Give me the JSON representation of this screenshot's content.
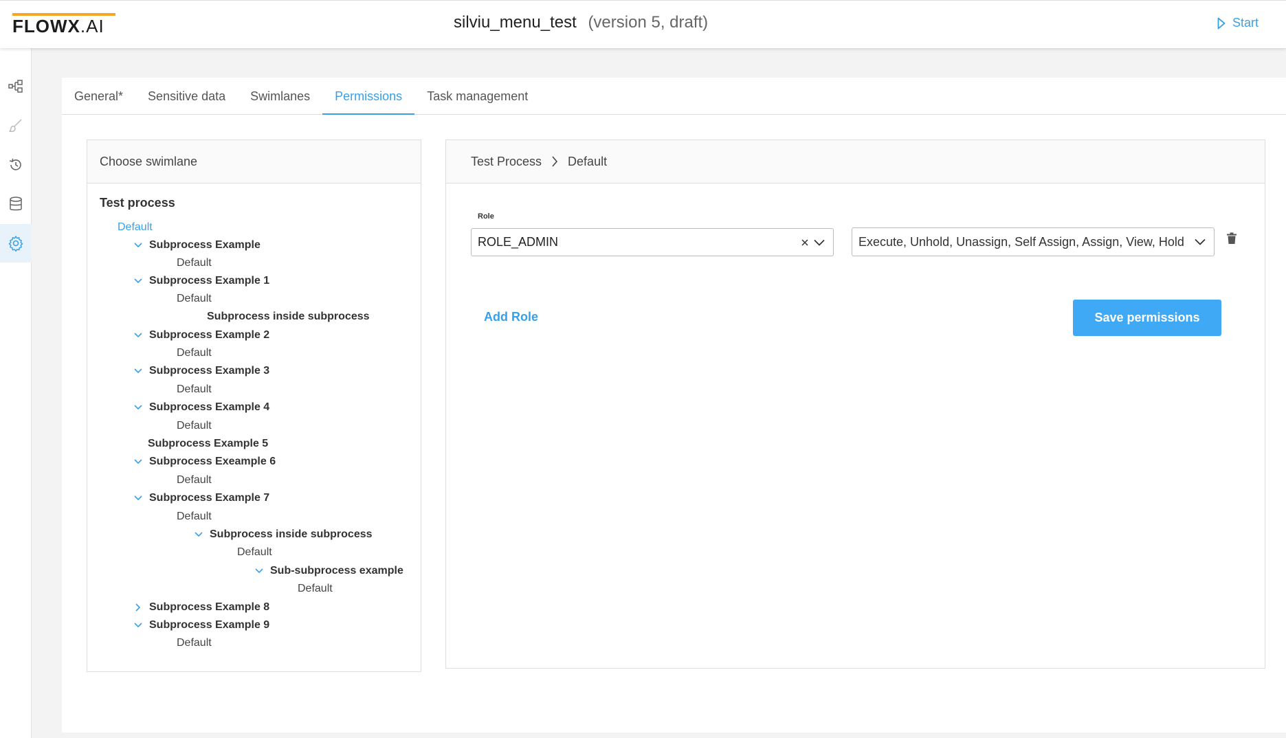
{
  "header": {
    "logo_main": "FLOWX",
    "logo_suffix": ".AI",
    "process_name": "silviu_menu_test",
    "version": "(version 5, draft)",
    "start_label": "Start"
  },
  "rail": {
    "items": [
      {
        "icon": "process-diagram-icon"
      },
      {
        "icon": "brush-icon"
      },
      {
        "icon": "history-icon"
      },
      {
        "icon": "database-icon"
      },
      {
        "icon": "settings-gear-icon",
        "active": true
      }
    ]
  },
  "tabs": [
    {
      "label": "General*"
    },
    {
      "label": "Sensitive data"
    },
    {
      "label": "Swimlanes"
    },
    {
      "label": "Permissions",
      "active": true
    },
    {
      "label": "Task management"
    }
  ],
  "swimlane_panel": {
    "header": "Choose swimlane",
    "root": "Test process",
    "nodes": [
      {
        "label": "Default",
        "kind": "default",
        "selected": true
      },
      {
        "label": "Subprocess Example",
        "kind": "sub",
        "chevron": "down"
      },
      {
        "label": "Default",
        "kind": "default"
      },
      {
        "label": "Subprocess Example 1",
        "kind": "sub",
        "chevron": "down"
      },
      {
        "label": "Default",
        "kind": "default"
      },
      {
        "label": "Subprocess inside subprocess",
        "kind": "sub",
        "chevron": "none"
      },
      {
        "label": "Subprocess Example 2",
        "kind": "sub",
        "chevron": "down"
      },
      {
        "label": "Default",
        "kind": "default"
      },
      {
        "label": "Subprocess Example 3",
        "kind": "sub",
        "chevron": "down"
      },
      {
        "label": "Default",
        "kind": "default"
      },
      {
        "label": "Subprocess Example 4",
        "kind": "sub",
        "chevron": "down"
      },
      {
        "label": "Default",
        "kind": "default"
      },
      {
        "label": "Subprocess Example 5",
        "kind": "sub",
        "chevron": "none"
      },
      {
        "label": "Subprocess Exeample 6",
        "kind": "sub",
        "chevron": "down"
      },
      {
        "label": "Default",
        "kind": "default"
      },
      {
        "label": "Subprocess Example 7",
        "kind": "sub",
        "chevron": "down"
      },
      {
        "label": "Default",
        "kind": "default"
      },
      {
        "label": "Subprocess inside subprocess",
        "kind": "sub",
        "chevron": "down"
      },
      {
        "label": "Default",
        "kind": "default"
      },
      {
        "label": "Sub-subprocess example",
        "kind": "sub",
        "chevron": "down"
      },
      {
        "label": "Default",
        "kind": "default"
      },
      {
        "label": "Subprocess Example 8",
        "kind": "sub",
        "chevron": "right"
      },
      {
        "label": "Subprocess Example 9",
        "kind": "sub",
        "chevron": "down"
      },
      {
        "label": "Default",
        "kind": "default"
      }
    ]
  },
  "permissions_panel": {
    "breadcrumb": [
      "Test Process",
      "Default"
    ],
    "role_label": "Role",
    "role_value": "ROLE_ADMIN",
    "permissions_value": "Execute, Unhold, Unassign, Self Assign, Assign, View, Hold",
    "add_role_label": "Add Role",
    "save_label": "Save permissions"
  },
  "colors": {
    "accent": "#3aa0e6",
    "button": "#3fa9f5",
    "logo_bar": "#f5a623"
  }
}
